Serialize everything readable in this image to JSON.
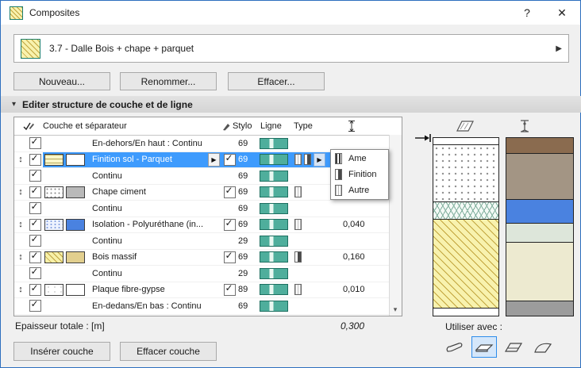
{
  "window": {
    "title": "Composites"
  },
  "icons": {
    "help": "?",
    "close": "✕",
    "section_collapse": "▾",
    "flyout_arrow": "▶",
    "drag_handle": "↕",
    "scroll_down": "▾",
    "selector_arrow": "▶"
  },
  "selector": {
    "value": "3.7 - Dalle Bois + chape + parquet"
  },
  "actions": {
    "new": "Nouveau...",
    "rename": "Renommer...",
    "delete": "Effacer..."
  },
  "section": {
    "title": "Editer structure de couche et de ligne"
  },
  "table": {
    "headers": {
      "layer": "Couche et séparateur",
      "pen": "Stylo",
      "line": "Ligne",
      "type": "Type"
    },
    "rows": [
      {
        "kind": "separator",
        "name": "En-dehors/En haut : Continu",
        "pen": "69",
        "checked": true
      },
      {
        "kind": "layer",
        "name": "Finition sol - Parquet",
        "pen": "69",
        "checked": true,
        "pen_checked": true,
        "thickness": "",
        "selected": true
      },
      {
        "kind": "separator",
        "name": "Continu",
        "pen": "69",
        "checked": true
      },
      {
        "kind": "layer",
        "name": "Chape ciment",
        "pen": "69",
        "checked": true,
        "pen_checked": true,
        "thickness": ""
      },
      {
        "kind": "separator",
        "name": "Continu",
        "pen": "69",
        "checked": true
      },
      {
        "kind": "layer",
        "name": "Isolation - Polyuréthane (in...",
        "pen": "69",
        "checked": true,
        "pen_checked": true,
        "thickness": "0,040"
      },
      {
        "kind": "separator",
        "name": "Continu",
        "pen": "29",
        "checked": true
      },
      {
        "kind": "layer",
        "name": "Bois massif",
        "pen": "69",
        "checked": true,
        "pen_checked": true,
        "thickness": "0,160"
      },
      {
        "kind": "separator",
        "name": "Continu",
        "pen": "29",
        "checked": true
      },
      {
        "kind": "layer",
        "name": "Plaque fibre-gypse",
        "pen": "89",
        "checked": true,
        "pen_checked": true,
        "thickness": "0,010"
      },
      {
        "kind": "separator",
        "name": "En-dedans/En bas : Continu",
        "pen": "69",
        "checked": true
      }
    ]
  },
  "type_menu": {
    "items": [
      {
        "label": "Ame",
        "icon": "core-skin-icon"
      },
      {
        "label": "Finition",
        "icon": "finish-skin-icon"
      },
      {
        "label": "Autre",
        "icon": "other-skin-icon"
      }
    ]
  },
  "totals": {
    "label": "Epaisseur totale :  [m]",
    "value": "0,300"
  },
  "footer_actions": {
    "insert": "Insérer couche",
    "delete": "Effacer couche"
  },
  "use_with": {
    "label": "Utiliser avec :",
    "options": [
      "wall",
      "slab",
      "roof",
      "shell"
    ],
    "selected": "slab"
  },
  "colors": {
    "selection": "#3e9bfd",
    "line_swatch_teal": "#4fae9c",
    "isolation_blue": "#4a82e0"
  },
  "preview": {
    "cut_layers": [
      {
        "h": "4%",
        "pattern": "pat-plain",
        "material": "parquet"
      },
      {
        "h": "32%",
        "pattern": "pat-stipple",
        "material": "chape-ciment"
      },
      {
        "h": "10%",
        "pattern": "pat-iso",
        "material": "isolation"
      },
      {
        "h": "50%",
        "pattern": "pat-wood",
        "material": "bois-massif"
      },
      {
        "h": "4%",
        "pattern": "pat-plain",
        "material": "plaque-fibre-gypse"
      }
    ],
    "surface_layers": [
      {
        "h": "9%",
        "color": "#8a6b4f"
      },
      {
        "h": "26%",
        "color": "#a39584"
      },
      {
        "h": "13%",
        "color": "#4a82e0"
      },
      {
        "h": "11%",
        "color": "#dde6da"
      },
      {
        "h": "33%",
        "color": "#edead0"
      },
      {
        "h": "8%",
        "color": "#9c9c9c"
      }
    ]
  }
}
